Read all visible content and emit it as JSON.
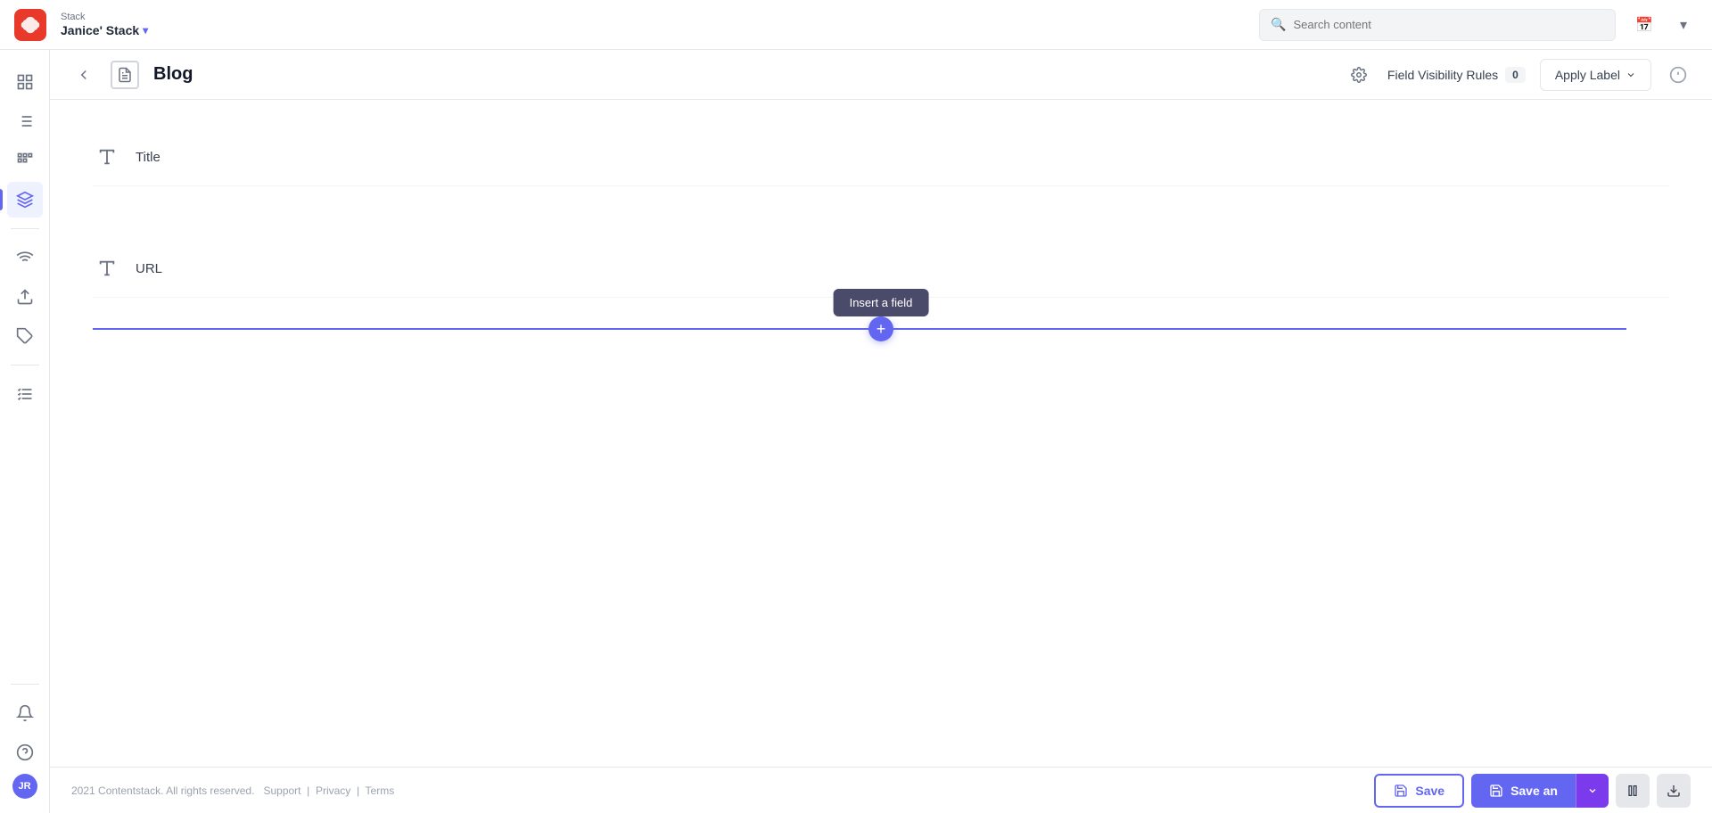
{
  "header": {
    "logo_alt": "Contentstack Logo",
    "stack_label": "Stack",
    "stack_name": "Janice' Stack",
    "search_placeholder": "Search content"
  },
  "sidebar": {
    "items": [
      {
        "id": "dashboard",
        "label": "Dashboard",
        "icon": "grid"
      },
      {
        "id": "content-types",
        "label": "Content Types",
        "icon": "list"
      },
      {
        "id": "entries",
        "label": "Entries",
        "icon": "layers",
        "active": true
      },
      {
        "id": "widgets",
        "label": "Widgets",
        "icon": "widget"
      }
    ],
    "bottom_items": [
      {
        "id": "notifications",
        "label": "Notifications",
        "icon": "bell"
      },
      {
        "id": "help",
        "label": "Help",
        "icon": "help-circle"
      }
    ],
    "avatar_initials": "JR"
  },
  "content": {
    "back_label": "Back",
    "page_icon": "📄",
    "page_title": "Blog",
    "settings_label": "Settings",
    "visibility_rules_label": "Field Visibility Rules",
    "visibility_count": "0",
    "apply_label_btn": "Apply Label",
    "info_label": "Info",
    "fields": [
      {
        "id": "title-field",
        "type_icon": "A",
        "label": "Title"
      },
      {
        "id": "url-field",
        "type_icon": "A",
        "label": "URL"
      }
    ],
    "insert_field_tooltip": "Insert a field",
    "insert_plus_label": "+"
  },
  "footer": {
    "copyright": "2021 Contentstack. All rights reserved.",
    "support_label": "Support",
    "privacy_label": "Privacy",
    "terms_label": "Terms",
    "save_label": "Save",
    "save_and_label": "Save an",
    "save_icon": "💾"
  }
}
